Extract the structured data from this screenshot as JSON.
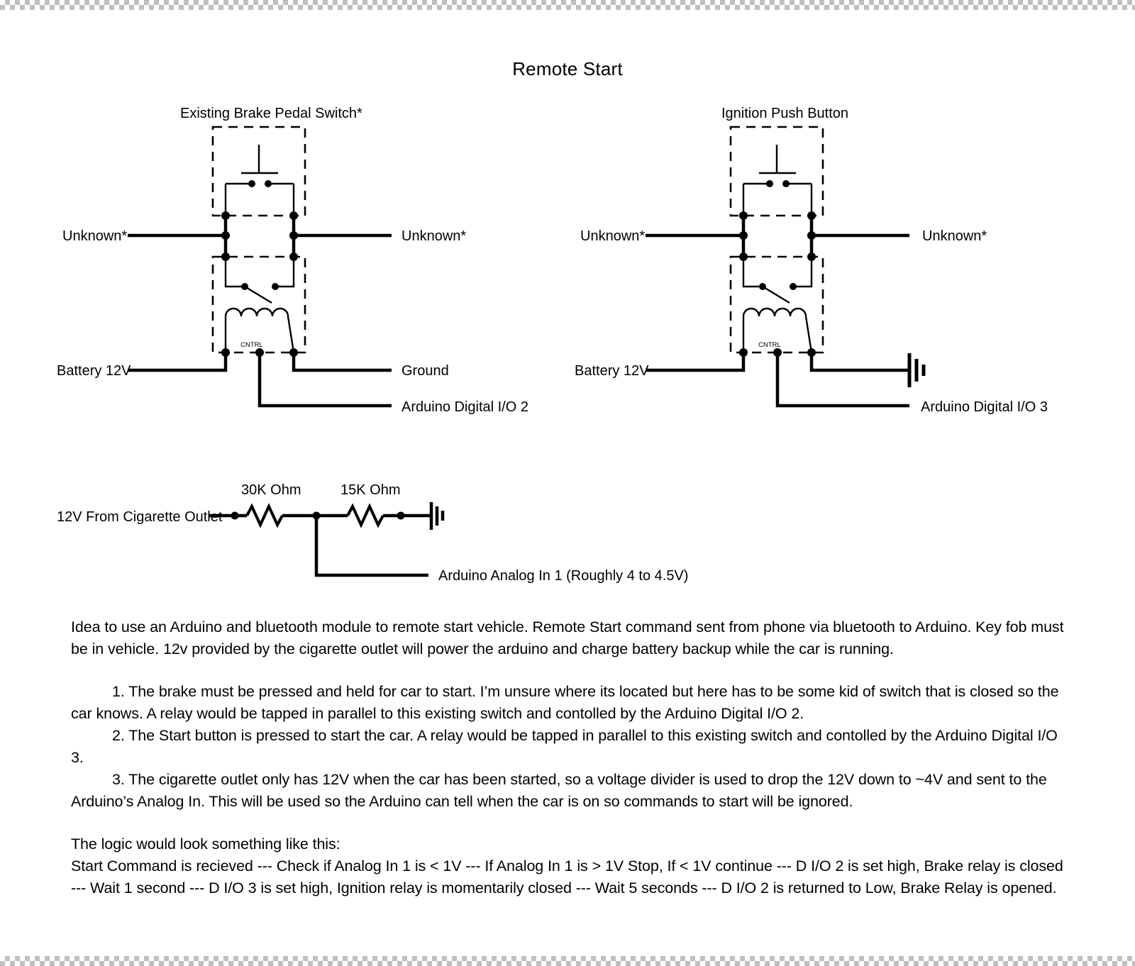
{
  "document": {
    "title": "Remote Start"
  },
  "circuits": {
    "brake": {
      "box_label": "Existing Brake Pedal Switch*",
      "left_terminal_label": "Unknown*",
      "right_terminal_label": "Unknown*",
      "bottom_left_label": "Battery 12V",
      "bottom_right_label": "Ground",
      "control_label": "Arduino Digital I/O 2",
      "coil_label": "CNTRL"
    },
    "ignition": {
      "box_label": "Ignition Push Button",
      "left_terminal_label": "Unknown*",
      "right_terminal_label": "Unknown*",
      "bottom_left_label": "Battery 12V",
      "bottom_right_label": "",
      "control_label": "Arduino Digital I/O 3",
      "coil_label": "CNTRL"
    },
    "divider": {
      "source_label": "12V From Cigarette Outlet",
      "resistor_1_label": "30K Ohm",
      "resistor_2_label": "15K Ohm",
      "output_label": "Arduino Analog In 1 (Roughly 4 to 4.5V)"
    }
  },
  "notes": {
    "intro": "Idea to use an Arduino and bluetooth module to remote start vehicle. Remote Start command sent from phone via bluetooth to Arduino. Key fob must be in vehicle. 12v provided by the cigarette outlet will power the arduino and charge battery backup while the car is running.",
    "steps": [
      "1. The brake must be pressed and held for car to start. I’m unsure where its located but here has to be some kid of switch that is closed so the car knows. A relay would be tapped in parallel to this existing switch and contolled by the Arduino Digital I/O 2.",
      "2. The Start button is pressed to start the car. A relay would be tapped in parallel to this existing switch and contolled by the Arduino Digital I/O 3.",
      "3. The cigarette outlet only has 12V when the car has been started, so a voltage divider is used to drop the 12V down to ~4V and sent to the Arduino’s Analog In. This will be used so the Arduino can tell when the car is on so commands to start will be ignored."
    ],
    "logic_heading": "The logic would look something like this:",
    "logic_body": "Start Command is recieved --- Check if Analog In 1 is < 1V --- If Analog In 1 is > 1V Stop, If  < 1V continue --- D I/O 2 is set high, Brake relay is closed --- Wait 1 second --- D I/O 3 is set high, Ignition relay is momentarily closed --- Wait 5 seconds --- D I/O 2 is returned to Low, Brake Relay is opened."
  },
  "colors": {
    "ink": "#000000",
    "paper": "#ffffff"
  }
}
